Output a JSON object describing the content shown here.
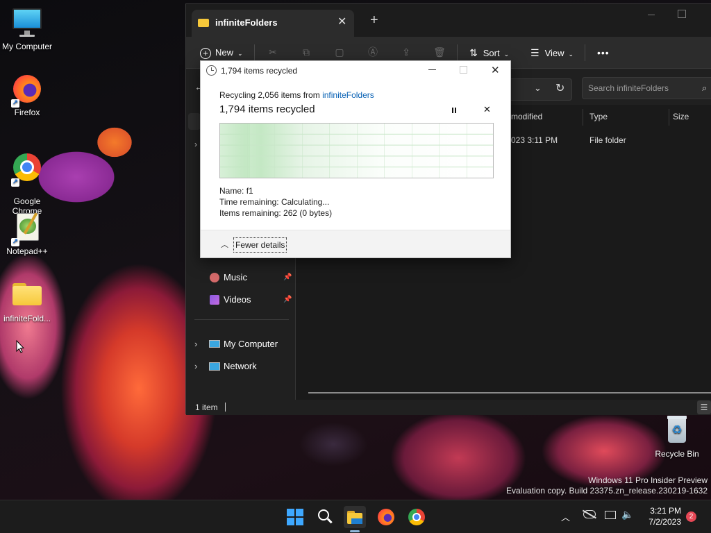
{
  "desktop": {
    "icons": [
      {
        "label": "My Computer"
      },
      {
        "label": "Firefox"
      },
      {
        "label": "Google\nChrome"
      },
      {
        "label": "Notepad++"
      },
      {
        "label": "infiniteFold..."
      }
    ],
    "recycle_bin": "Recycle Bin",
    "watermark": {
      "line1": "Windows 11 Pro Insider Preview",
      "line2": "Evaluation copy. Build 23375.zn_release.230219-1632"
    }
  },
  "explorer": {
    "tab_title": "infiniteFolders",
    "new_tab": "+",
    "toolbar": {
      "new": "New",
      "sort": "Sort",
      "view": "View",
      "more": "•••"
    },
    "search_placeholder": "Search infiniteFolders",
    "columns": {
      "modified": "modified",
      "type": "Type",
      "size": "Size"
    },
    "row": {
      "modified": "023 3:11 PM",
      "type": "File folder"
    },
    "nav": {
      "music": "Music",
      "videos": "Videos",
      "my_computer": "My Computer",
      "network": "Network"
    },
    "status": "1 item"
  },
  "dialog": {
    "title": "1,794 items recycled",
    "recycling_prefix": "Recycling 2,056 items from ",
    "recycling_link": "infiniteFolders",
    "heading": "1,794 items recycled",
    "progress_fraction": 0.11,
    "name_label": "Name:",
    "name_value": "f1",
    "time_label": "Time remaining:",
    "time_value": "Calculating...",
    "items_label": "Items remaining:",
    "items_value": "262 (0 bytes)",
    "fewer_details": "Fewer details"
  },
  "taskbar": {
    "time": "3:21 PM",
    "date": "7/2/2023",
    "notification_count": "2"
  },
  "icons": [
    "monitor-icon",
    "firefox-icon",
    "chrome-icon",
    "notepad-plus-plus-icon",
    "folder-icon",
    "recycle-bin-icon",
    "start-icon",
    "search-icon",
    "file-explorer-icon"
  ],
  "colors": {
    "accent": "#0067c0",
    "link": "#0b63b5",
    "graph_green": "#c4e8c4",
    "badge": "#e74856"
  }
}
